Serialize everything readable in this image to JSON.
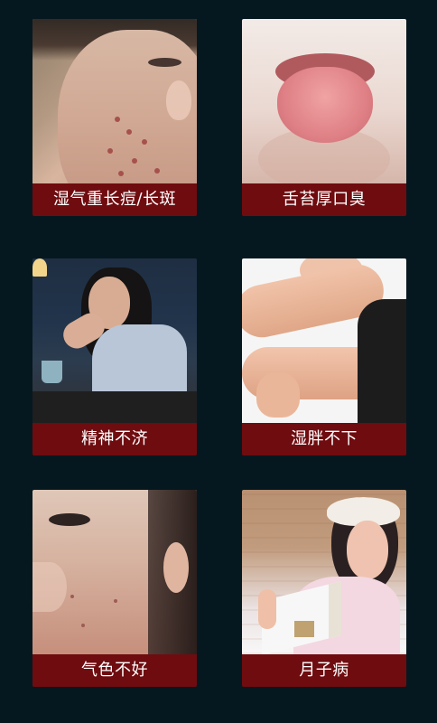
{
  "cards": [
    {
      "label": "湿气重长痘/长斑"
    },
    {
      "label": "舌苔厚口臭"
    },
    {
      "label": "精神不济"
    },
    {
      "label": "湿胖不下"
    },
    {
      "label": "气色不好"
    },
    {
      "label": "月子病"
    }
  ],
  "colors": {
    "background": "#06181f",
    "label_bar": "#6f0c10",
    "label_text": "#ffffff"
  }
}
